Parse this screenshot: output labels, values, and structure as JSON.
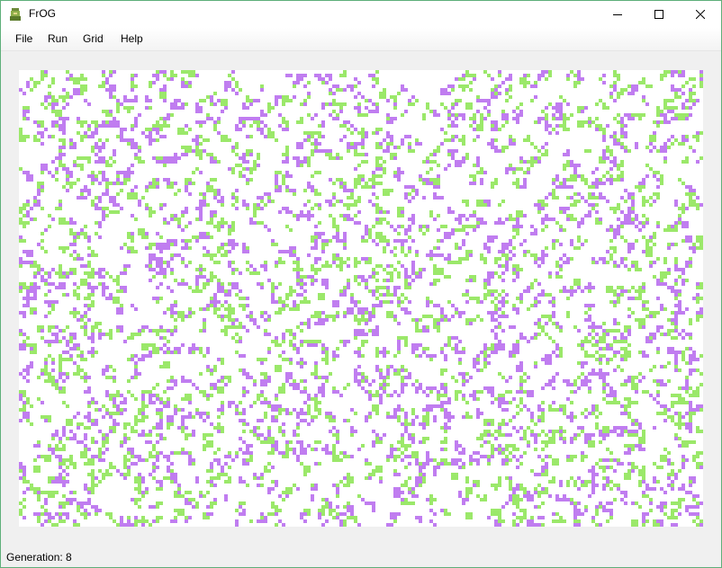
{
  "window": {
    "title": "FrOG",
    "app_icon": "frog-icon",
    "controls": [
      "minimize-icon",
      "maximize-icon",
      "close-icon"
    ]
  },
  "menu": {
    "items": [
      {
        "label": "File"
      },
      {
        "label": "Run"
      },
      {
        "label": "Grid"
      },
      {
        "label": "Help"
      }
    ]
  },
  "grid": {
    "colors": {
      "dead": "#ffffff",
      "green": "#9be86a",
      "purple": "#c07df0"
    }
  },
  "status": {
    "generation_label": "Generation: 8"
  },
  "colors": {
    "window_bg": "#f0f0f0",
    "window_border": "#5eaf7a",
    "titlebar": "#ffffff"
  }
}
